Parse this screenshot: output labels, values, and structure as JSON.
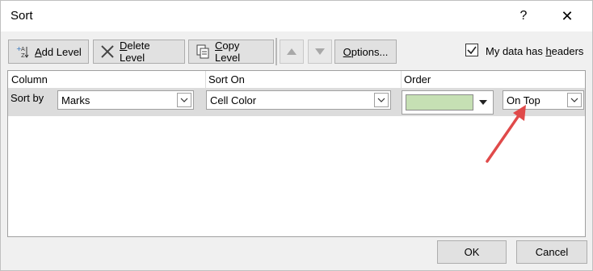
{
  "window": {
    "title": "Sort",
    "help": "?",
    "close": "✕"
  },
  "toolbar": {
    "add_level": {
      "prefix": "",
      "underlined": "A",
      "rest": "dd Level"
    },
    "delete_level": {
      "underlined": "D",
      "rest": "elete Level"
    },
    "copy_level": {
      "underlined": "C",
      "rest": "opy Level"
    },
    "options": {
      "underlined": "O",
      "rest": "ptions..."
    }
  },
  "headers_checkbox": {
    "checked": true,
    "label_pre": "My data has ",
    "label_underlined": "h",
    "label_post": "eaders"
  },
  "grid": {
    "column_header": "Column",
    "sort_on_header": "Sort On",
    "order_header": "Order",
    "row": {
      "label": "Sort by",
      "column_value": "Marks",
      "sort_on_value": "Cell Color",
      "order_color": "#c6e0b4",
      "position_value": "On Top"
    }
  },
  "footer": {
    "ok": "OK",
    "cancel": "Cancel"
  },
  "colors": {
    "annotation_arrow": "#e04a4a",
    "dialog_bg": "#f0f0f0"
  }
}
